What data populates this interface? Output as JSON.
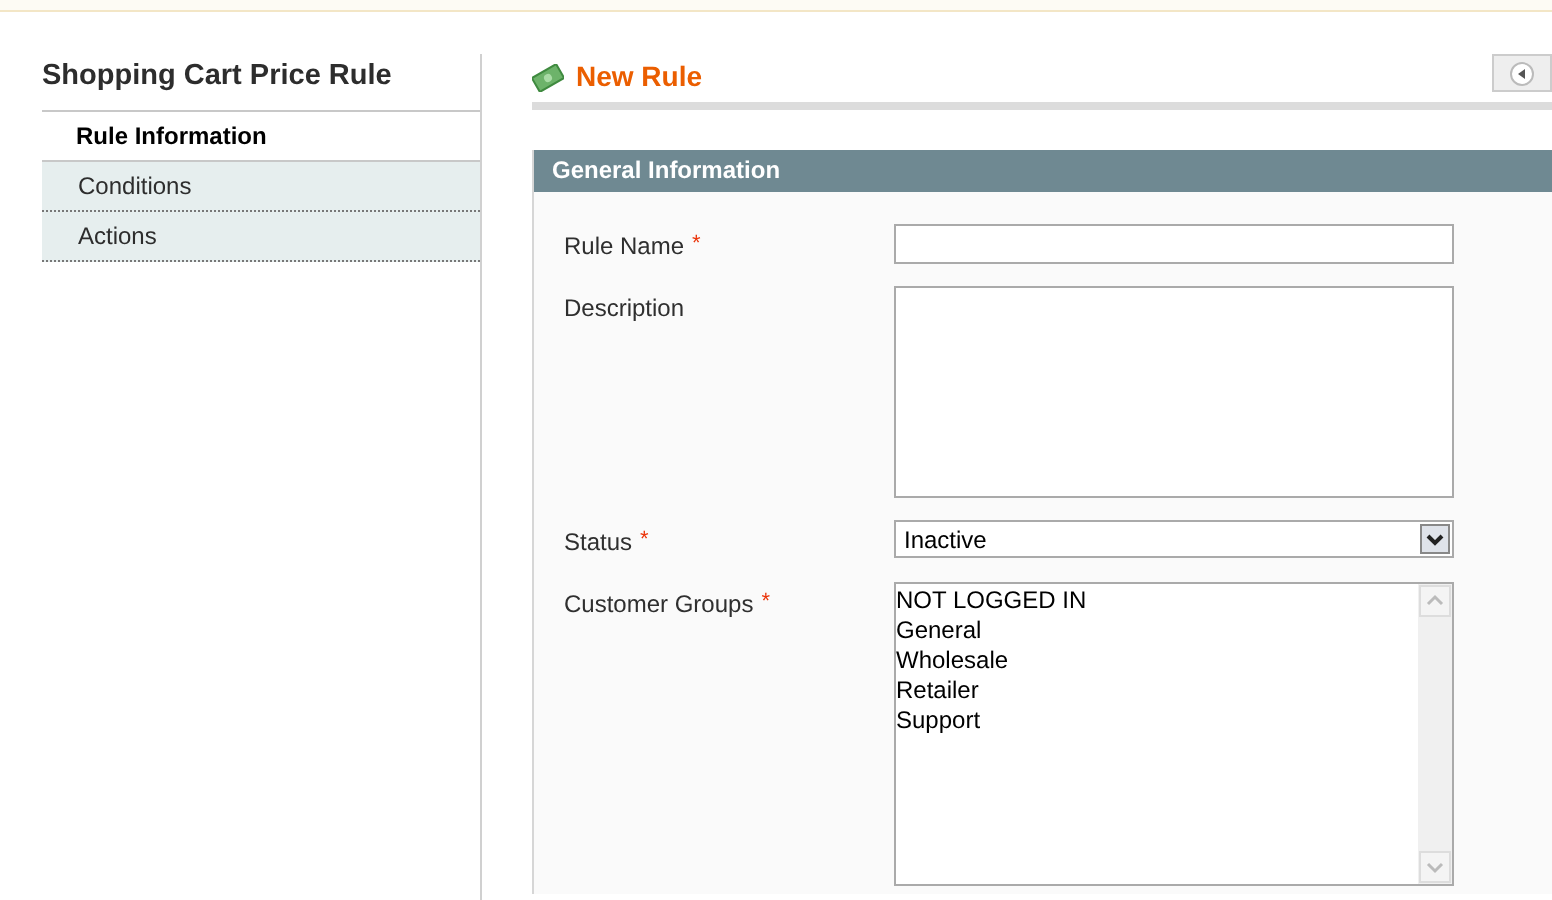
{
  "sidebar": {
    "title": "Shopping Cart Price Rule",
    "tabs": [
      {
        "label": "Rule Information",
        "selected": true
      },
      {
        "label": "Conditions",
        "selected": false
      },
      {
        "label": "Actions",
        "selected": false
      }
    ]
  },
  "page": {
    "title": "New Rule"
  },
  "fieldset": {
    "title": "General Information",
    "fields": [
      {
        "kind": "text",
        "label": "Rule Name",
        "required_mark": "*"
      },
      {
        "kind": "textarea",
        "label": "Description"
      },
      {
        "kind": "select",
        "label": "Status",
        "required_mark": "*",
        "value": "Inactive"
      },
      {
        "kind": "multiselect",
        "label": "Customer Groups",
        "required_mark": "*",
        "options": [
          {
            "label": "NOT LOGGED IN",
            "selected": false
          },
          {
            "label": "General",
            "selected": false
          },
          {
            "label": "Wholesale",
            "selected": false
          },
          {
            "label": "Retailer",
            "selected": false
          },
          {
            "label": "Support",
            "selected": false
          }
        ]
      }
    ]
  }
}
